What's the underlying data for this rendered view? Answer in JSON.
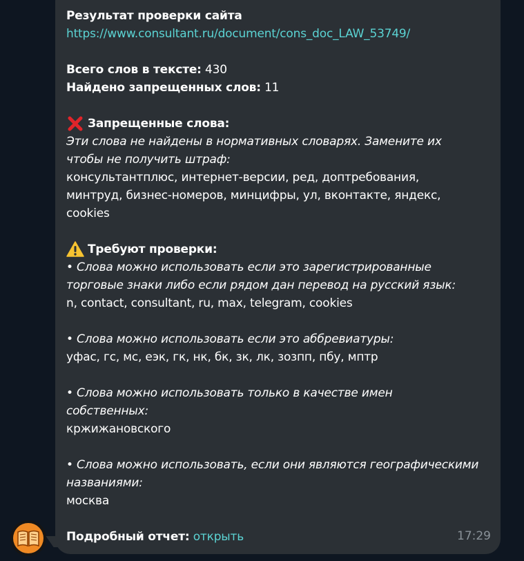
{
  "message": {
    "header": "Результат проверки сайта",
    "site_url": "https://www.consultant.ru/document/cons_doc_LAW_53749/",
    "total_words_label": "Всего слов в тексте:",
    "total_words_value": "430",
    "forbidden_count_label": "Найдено запрещенных слов:",
    "forbidden_count_value": "11",
    "forbidden_section": {
      "title": "Запрещенные слова:",
      "note_line1": "Эти слова не найдены в нормативных словарях. Замените их",
      "note_line2": "чтобы не получить штраф:",
      "words_line1": "консультантплюс, интернет-версии, ред, доптребования,",
      "words_line2": "минтруд, бизнес-номеров, минцифры, ул, вконтакте, яндекс,",
      "words_line3": "cookies"
    },
    "review_section": {
      "title": "Требуют проверки:",
      "trademark_note_line1": "• Слова можно использовать если это зарегистрированные",
      "trademark_note_line2": "торговые знаки либо если рядом дан перевод на русский язык:",
      "trademark_words": "n, contact, consultant, ru, max, telegram, cookies",
      "abbr_note": "• Слова можно использовать если это аббревиатуры:",
      "abbr_words": "уфас, гс, мс, еэк, гк, нк, бк, зк, лк, зозпп, пбу, мптр",
      "proper_note_line1": "• Слова можно использовать только в качестве имен",
      "proper_note_line2": "собственных:",
      "proper_words": "кржижановского",
      "geo_note_line1": "• Слова можно использовать, если они являются географическими",
      "geo_note_line2": "названиями:",
      "geo_words": "москва"
    },
    "report_label": "Подробный отчет:",
    "report_link": "открыть",
    "time": "17:29"
  },
  "icons": {
    "forbidden": "cross-mark-icon",
    "review": "warning-icon",
    "avatar": "open-book-icon"
  },
  "colors": {
    "background": "#0e1621",
    "bubble": "#2b3035",
    "link": "#5bd3d3",
    "timestamp": "#8a9299",
    "avatar_accent": "#f08a24"
  }
}
